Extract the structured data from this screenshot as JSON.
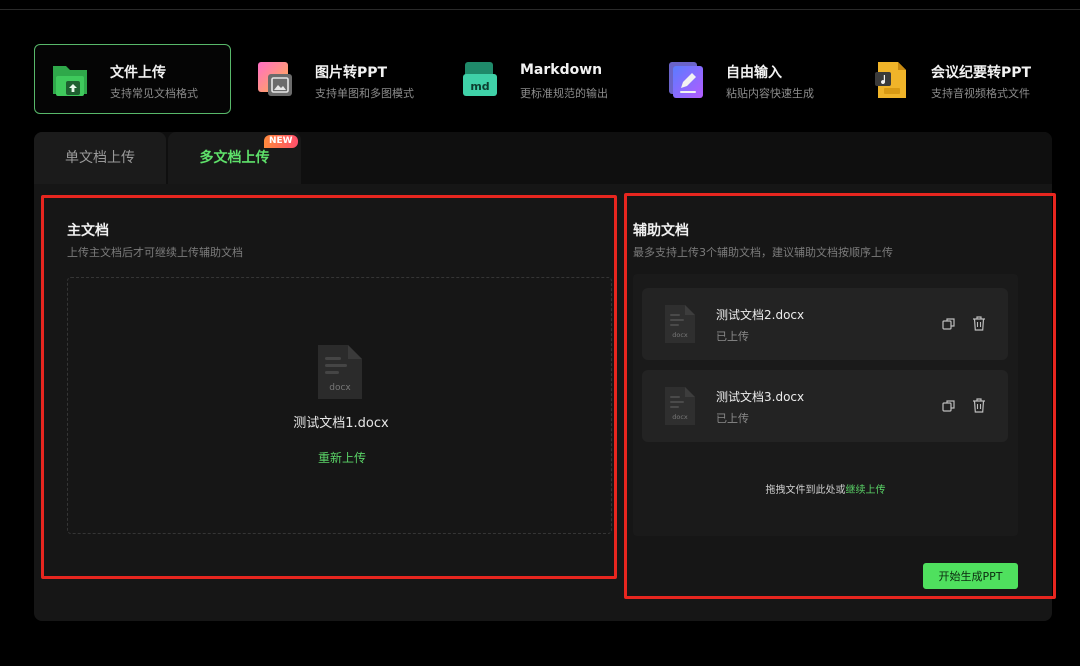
{
  "modes": [
    {
      "title": "文件上传",
      "desc": "支持常见文档格式",
      "icon": "folder-upload-icon",
      "active": true
    },
    {
      "title": "图片转PPT",
      "desc": "支持单图和多图模式",
      "icon": "image-to-ppt-icon",
      "active": false
    },
    {
      "title": "Markdown",
      "desc": "更标准规范的输出",
      "icon": "markdown-icon",
      "active": false,
      "icon_text": "md"
    },
    {
      "title": "自由输入",
      "desc": "粘贴内容快速生成",
      "icon": "edit-icon",
      "active": false
    },
    {
      "title": "会议纪要转PPT",
      "desc": "支持音视频格式文件",
      "icon": "meeting-notes-icon",
      "active": false
    }
  ],
  "tabs": {
    "single": "单文档上传",
    "multi": "多文档上传",
    "multi_badge": "NEW",
    "active": "multi"
  },
  "main_doc": {
    "title": "主文档",
    "subtitle": "上传主文档后才可继续上传辅助文档",
    "file_type": "docx",
    "file_name": "测试文档1.docx",
    "reupload_label": "重新上传"
  },
  "aux_docs": {
    "title": "辅助文档",
    "subtitle": "最多支持上传3个辅助文档，建议辅助文档按顺序上传",
    "files": [
      {
        "name": "测试文档2.docx",
        "status": "已上传",
        "type": "docx"
      },
      {
        "name": "测试文档3.docx",
        "status": "已上传",
        "type": "docx"
      }
    ],
    "drag_hint_prefix": "拖拽文件到此处或",
    "drag_hint_link": "继续上传"
  },
  "generate_button": "开始生成PPT",
  "colors": {
    "accent": "#4fe05e",
    "highlight_box": "#e7261f",
    "background": "#000000",
    "panel": "#161616"
  }
}
